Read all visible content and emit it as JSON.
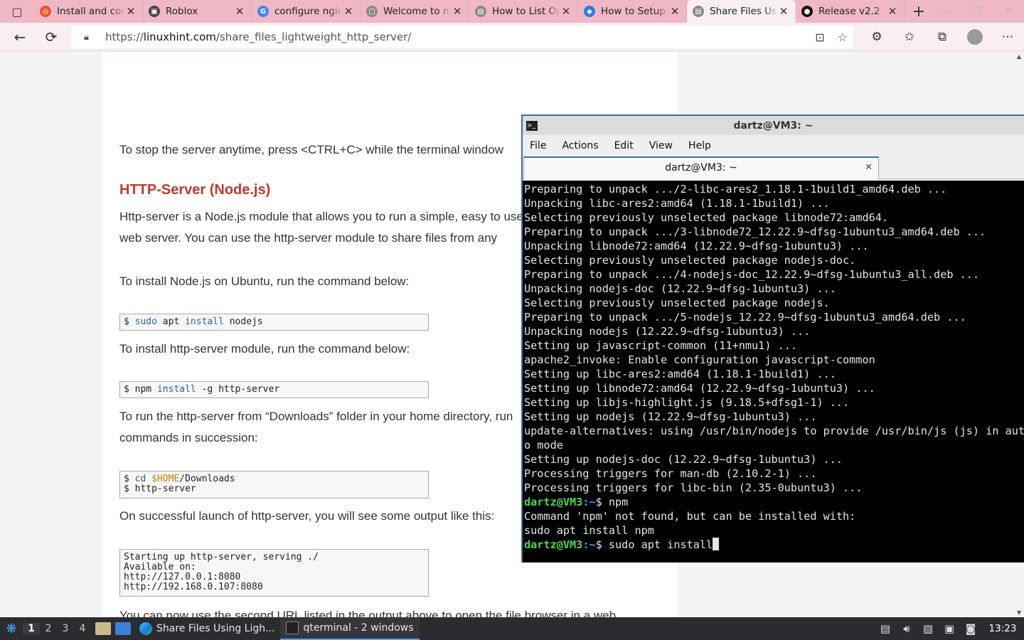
{
  "browser": {
    "tabs": [
      {
        "title": "Install and configure",
        "color": "#e95420",
        "glyph": "◎",
        "active": false
      },
      {
        "title": "Roblox",
        "color": "#444444",
        "glyph": "▣",
        "active": false
      },
      {
        "title": "configure nginx",
        "color": "#4285f4",
        "glyph": "G",
        "active": false
      },
      {
        "title": "Welcome to nginx",
        "color": "#888888",
        "glyph": "▢",
        "active": false
      },
      {
        "title": "How to List Open",
        "color": "#888888",
        "glyph": "▤",
        "active": false
      },
      {
        "title": "How to Setup",
        "color": "#2a7de1",
        "glyph": "◆",
        "active": false
      },
      {
        "title": "Share Files Using",
        "color": "#888888",
        "glyph": "▤",
        "active": true
      },
      {
        "title": "Release v2.2",
        "color": "#111111",
        "glyph": "●",
        "active": false
      }
    ],
    "new_tab": "+",
    "url_scheme": "https://",
    "url_host": "linuxhint.com",
    "url_path": "/share_files_lightweight_http_server/"
  },
  "article": {
    "p1": "To stop the server anytime, press <CTRL+C> while the terminal window",
    "h_node": "HTTP-Server (Node.js)",
    "p2a": "Http-server is a Node.js module that allows you to run a simple, easy to use",
    "p2b": "web server. You can use the http-server module to share files from any",
    "p3": "To install Node.js on Ubuntu, run the command below:",
    "code1_prompt": "$ ",
    "code1_cmd1": "sudo",
    "code1_mid": " apt ",
    "code1_cmd2": "install",
    "code1_end": " nodejs",
    "p4": "To install http-server module, run the command below:",
    "code2_prompt": "$ npm ",
    "code2_kw": "install",
    "code2_end": " -g http-server",
    "p5a": "To run the http-server from “Downloads” folder in your home directory, run",
    "p5b": "commands in succession:",
    "code3_l1_prompt": "$ ",
    "code3_l1_kw": "cd",
    "code3_l1_sp": " ",
    "code3_l1_var": "$HOME",
    "code3_l1_end": "/Downloads",
    "code3_l2": "$ http-server",
    "p6": "On successful launch of http-server, you will see some output like this:",
    "code4": "Starting up http-server, serving ./\nAvailable on:\nhttp://127.0.0.1:8080\nhttp://192.168.0.107:8080",
    "p7": "You can now use the second URL listed in the output above to open the file browser in a web"
  },
  "terminal": {
    "title": "dartz@VM3: ~",
    "menu": [
      "File",
      "Actions",
      "Edit",
      "View",
      "Help"
    ],
    "tab_title": "dartz@VM3: ~",
    "output": "Preparing to unpack .../2-libc-ares2_1.18.1-1build1_amd64.deb ...\nUnpacking libc-ares2:amd64 (1.18.1-1build1) ...\nSelecting previously unselected package libnode72:amd64.\nPreparing to unpack .../3-libnode72_12.22.9~dfsg-1ubuntu3_amd64.deb ...\nUnpacking libnode72:amd64 (12.22.9~dfsg-1ubuntu3) ...\nSelecting previously unselected package nodejs-doc.\nPreparing to unpack .../4-nodejs-doc_12.22.9~dfsg-1ubuntu3_all.deb ...\nUnpacking nodejs-doc (12.22.9~dfsg-1ubuntu3) ...\nSelecting previously unselected package nodejs.\nPreparing to unpack .../5-nodejs_12.22.9~dfsg-1ubuntu3_amd64.deb ...\nUnpacking nodejs (12.22.9~dfsg-1ubuntu3) ...\nSetting up javascript-common (11+nmu1) ...\napache2_invoke: Enable configuration javascript-common\nSetting up libc-ares2:amd64 (1.18.1-1build1) ...\nSetting up libnode72:amd64 (12.22.9~dfsg-1ubuntu3) ...\nSetting up libjs-highlight.js (9.18.5+dfsg1-1) ...\nSetting up nodejs (12.22.9~dfsg-1ubuntu3) ...\nupdate-alternatives: using /usr/bin/nodejs to provide /usr/bin/js (js) in aut\no mode\nSetting up nodejs-doc (12.22.9~dfsg-1ubuntu3) ...\nProcessing triggers for man-db (2.10.2-1) ...\nProcessing triggers for libc-bin (2.35-0ubuntu3) ...",
    "prompt_user": "dartz@VM3",
    "prompt_path": ":~",
    "prompt_sign": "$ ",
    "cmd1": "npm",
    "not_found_1": "Command 'npm' not found, but can be installed with:",
    "not_found_2": "sudo apt install npm",
    "cmd2": "sudo apt install"
  },
  "taskbar": {
    "workspaces": [
      "1",
      "2",
      "3",
      "4"
    ],
    "task_browser": "Share Files Using Ligh...",
    "task_terminal": "qterminal - 2 windows",
    "clock": "13:23"
  },
  "colors": {
    "tabstrip": "#f0b8c6",
    "link_heading": "#c0392b",
    "terminal_prompt": "#4fd64f",
    "terminal_path": "#6a8cff"
  }
}
